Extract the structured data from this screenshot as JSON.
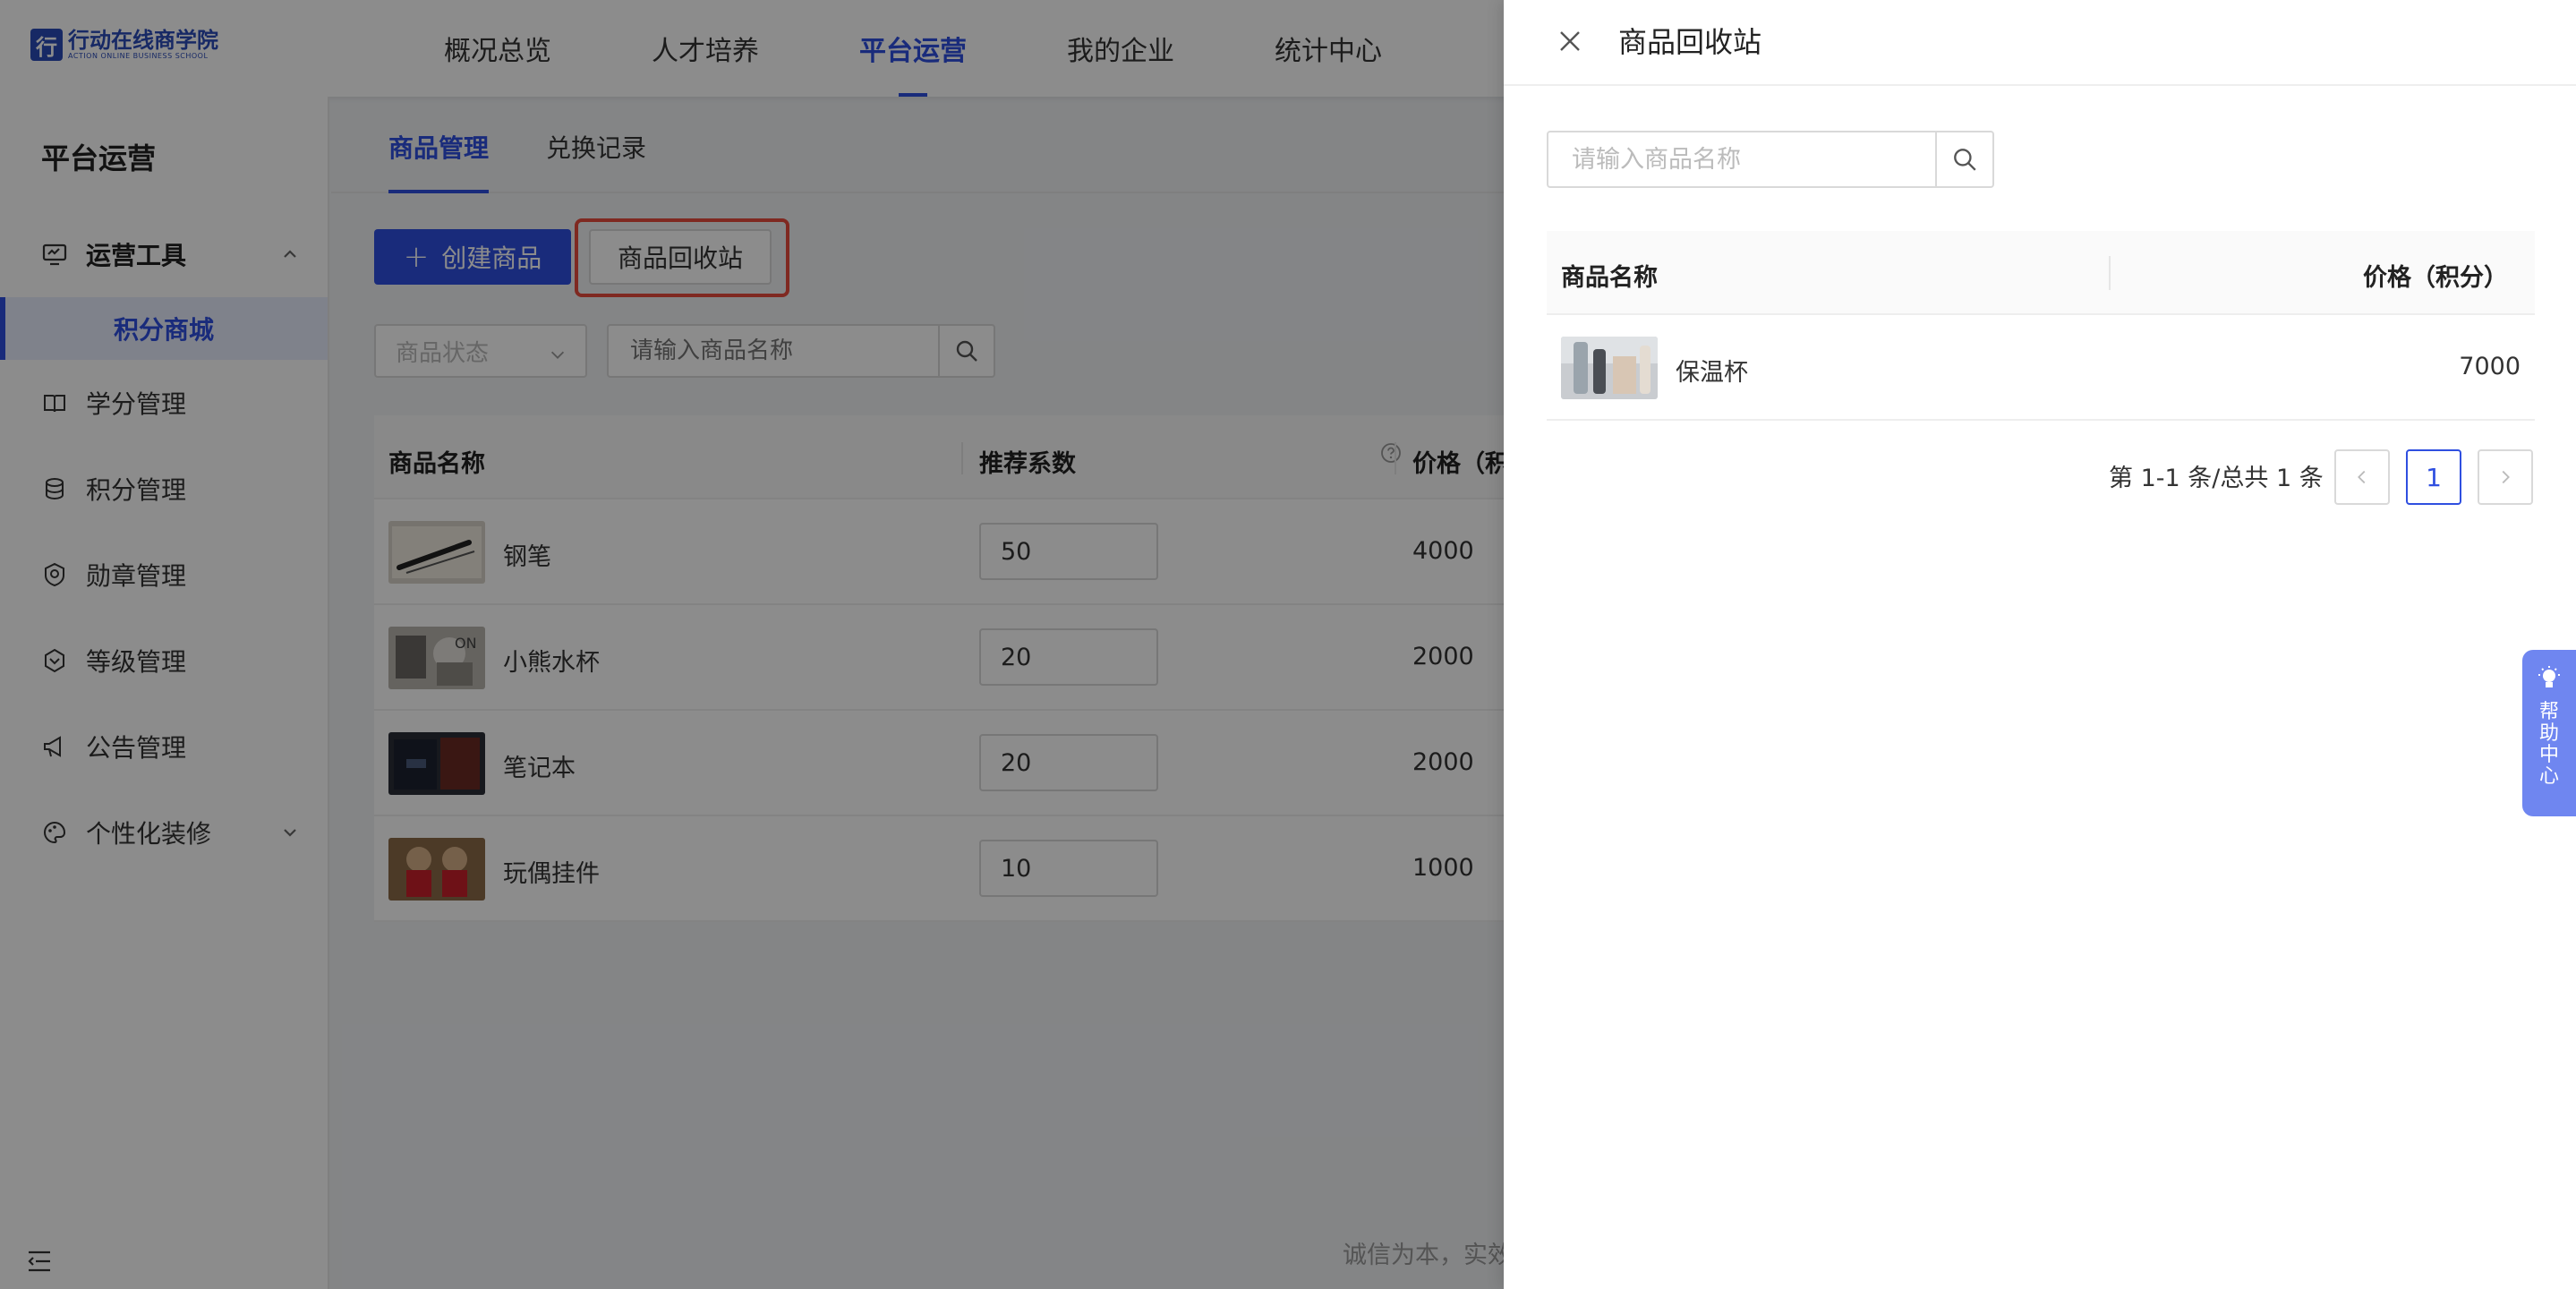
{
  "header": {
    "logo_cn": "行动在线商学院",
    "logo_en": "ACTION ONLINE BUSINESS SCHOOL",
    "nav": [
      "概况总览",
      "人才培养",
      "平台运营",
      "我的企业",
      "统计中心"
    ],
    "active_nav_index": 2
  },
  "sidebar": {
    "title": "平台运营",
    "items": [
      {
        "label": "运营工具",
        "icon": "monitor-icon",
        "open": true
      },
      {
        "label": "积分商城",
        "sub": true
      },
      {
        "label": "学分管理",
        "icon": "book-icon"
      },
      {
        "label": "积分管理",
        "icon": "coins-icon"
      },
      {
        "label": "勋章管理",
        "icon": "medal-icon"
      },
      {
        "label": "等级管理",
        "icon": "level-shield-icon"
      },
      {
        "label": "公告管理",
        "icon": "megaphone-icon"
      },
      {
        "label": "个性化装修",
        "icon": "palette-icon",
        "collapsed": true
      }
    ]
  },
  "main": {
    "tabs": [
      "商品管理",
      "兑换记录"
    ],
    "create_button": "创建商品",
    "recycle_button": "商品回收站",
    "status_select_placeholder": "商品状态",
    "search_placeholder": "请输入商品名称",
    "table_headers": {
      "name": "商品名称",
      "recommend": "推荐系数",
      "price": "价格（积分"
    },
    "rows": [
      {
        "name": "钢笔",
        "recommend": "50",
        "price": "4000"
      },
      {
        "name": "小熊水杯",
        "recommend": "20",
        "price": "2000"
      },
      {
        "name": "笔记本",
        "recommend": "20",
        "price": "2000"
      },
      {
        "name": "玩偶挂件",
        "recommend": "10",
        "price": "1000"
      }
    ],
    "footer_slogan": "诚信为本，实效"
  },
  "drawer": {
    "title": "商品回收站",
    "search_placeholder": "请输入商品名称",
    "table_headers": {
      "name": "商品名称",
      "price": "价格（积分）"
    },
    "rows": [
      {
        "name": "保温杯",
        "price": "7000"
      }
    ],
    "pagination": {
      "info": "第 1-1 条/总共 1 条",
      "current_page": "1"
    }
  },
  "help_center": "帮助中心",
  "colors": {
    "brand": "#2f4fe0",
    "highlight_border": "#e74c3c",
    "help_tab": "#6f86f0"
  }
}
